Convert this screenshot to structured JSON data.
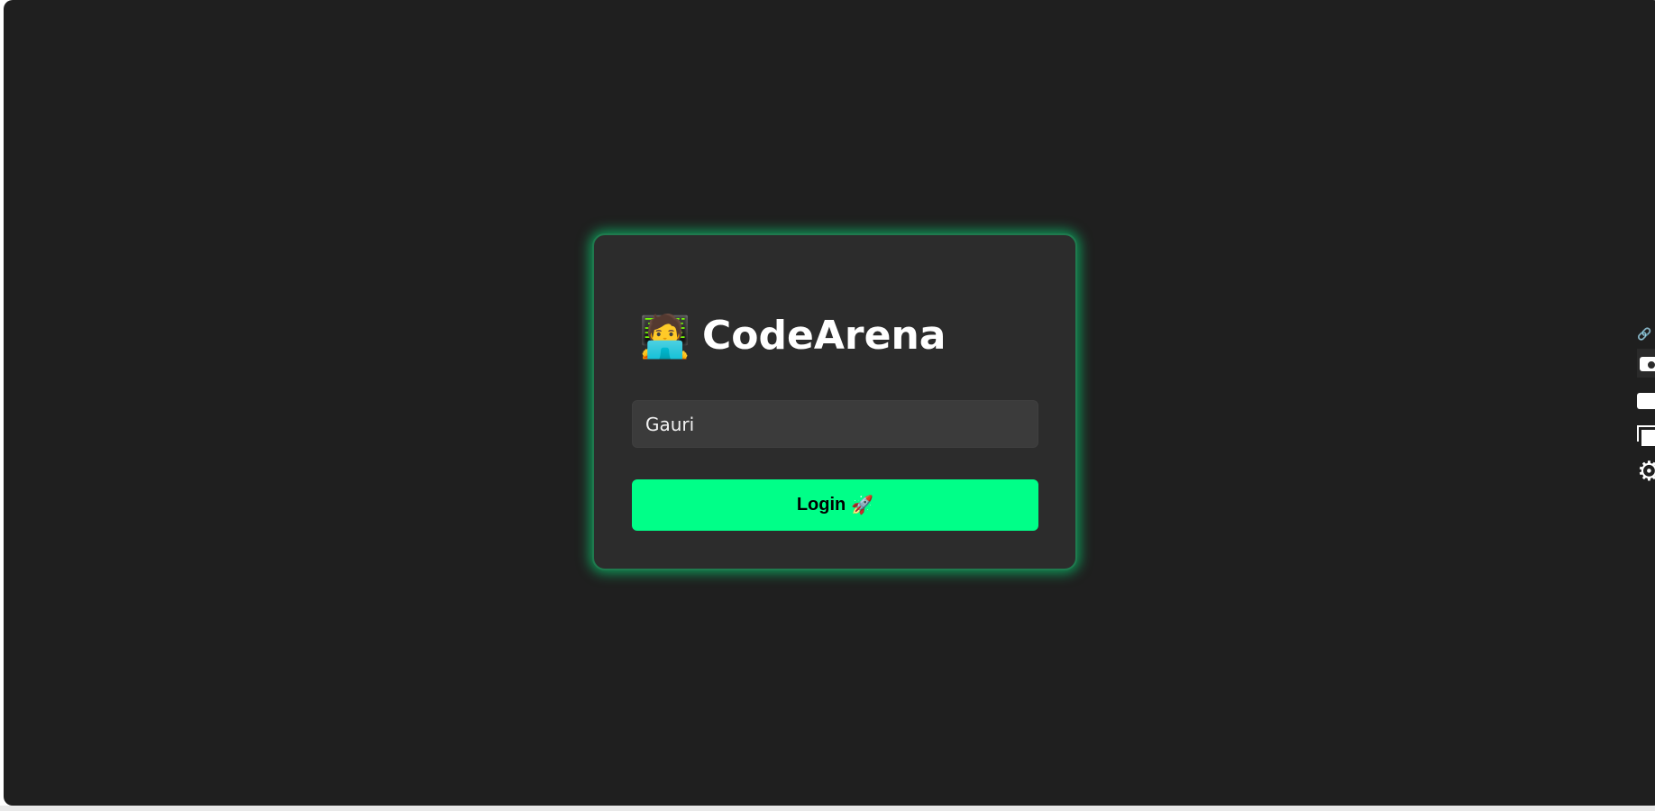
{
  "app": {
    "emoji": "🧑‍💻",
    "title": "CodeArena"
  },
  "login_form": {
    "name_value": "Gauri",
    "login_label": "Login",
    "login_icon": "🚀"
  },
  "side_toolbar": {
    "link_glyph": "🔗",
    "gear_glyph": "⚙",
    "icons": [
      "link-icon",
      "camera-icon",
      "video-icon",
      "window-icon",
      "gear-icon"
    ]
  },
  "colors": {
    "background": "#1f1f1f",
    "card": "#2c2c2c",
    "accent": "#00ff88",
    "input": "#3b3b3b"
  }
}
